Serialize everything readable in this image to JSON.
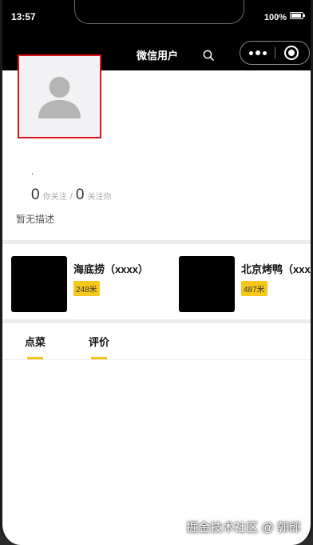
{
  "status_bar": {
    "time": "13:57",
    "battery": "100%"
  },
  "nav": {
    "title": "微信用户",
    "search_icon": "search-icon",
    "more_icon": "more-dots-icon",
    "close_icon": "mini-program-close-icon"
  },
  "profile": {
    "avatar_icon": "person-silhouette-icon",
    "nickname": ".",
    "following_count": "0",
    "following_label": "你关注",
    "separator": "/",
    "followers_count": "0",
    "followers_label": "关注你",
    "description": "暂无描述"
  },
  "restaurants": [
    {
      "name": "海底捞（xxxx）",
      "distance": "248米"
    },
    {
      "name": "北京烤鸭（xxxx）",
      "distance": "487米"
    }
  ],
  "tabs": [
    {
      "label": "点菜",
      "active": true
    },
    {
      "label": "评价",
      "active": false
    }
  ],
  "watermark": "掘金技术社区 @ 郭郎",
  "colors": {
    "accent": "#f6c81b",
    "header_bg": "#000000",
    "avatar_border": "#d9141c"
  }
}
